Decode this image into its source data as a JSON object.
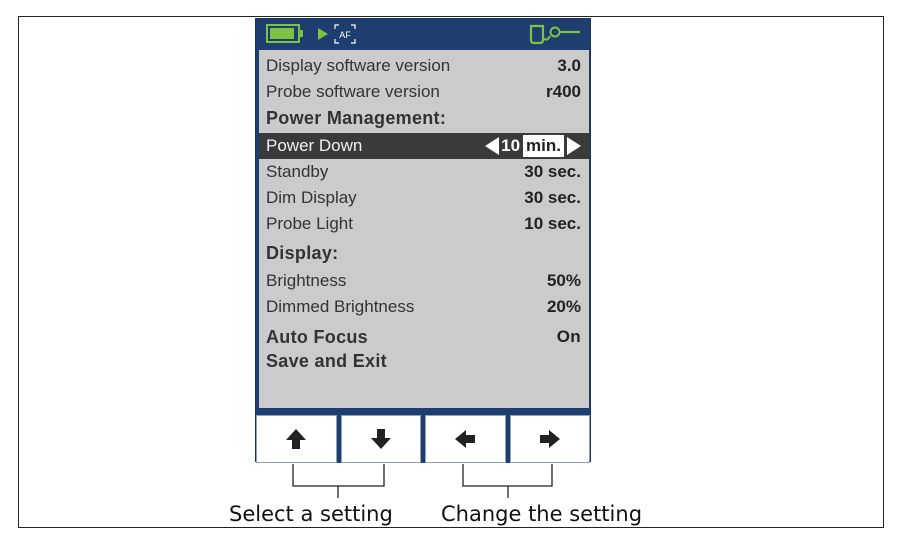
{
  "status_icons": [
    "battery-icon",
    "play-icon",
    "autofocus-icon",
    "probe-connected-icon"
  ],
  "status": {
    "af_label": "AF"
  },
  "settings": {
    "display_sw_label": "Display software version",
    "display_sw_value": "3.0",
    "probe_sw_label": "Probe software version",
    "probe_sw_value": "r400",
    "power_header": "Power Management:",
    "power_down_label": "Power Down",
    "power_down_value": "10",
    "power_down_unit": "min.",
    "standby_label": "Standby",
    "standby_value": "30 sec.",
    "dim_display_label": "Dim Display",
    "dim_display_value": "30 sec.",
    "probe_light_label": "Probe Light",
    "probe_light_value": "10 sec.",
    "display_header": "Display:",
    "brightness_label": "Brightness",
    "brightness_value": "50%",
    "dimmed_brightness_label": "Dimmed Brightness",
    "dimmed_brightness_value": "20%",
    "auto_focus_label": "Auto Focus",
    "auto_focus_value": "On",
    "save_exit_label": "Save and Exit"
  },
  "buttons": [
    "arrow-up-icon",
    "arrow-down-icon",
    "arrow-left-icon",
    "arrow-right-icon"
  ],
  "annotations": {
    "select_label": "Select a setting",
    "change_label": "Change the setting"
  },
  "colors": {
    "device_blue": "#1d3e6e",
    "screen_gray": "#cbcbcb",
    "selected_row": "#3a3a3a",
    "status_green": "#7dc242"
  }
}
